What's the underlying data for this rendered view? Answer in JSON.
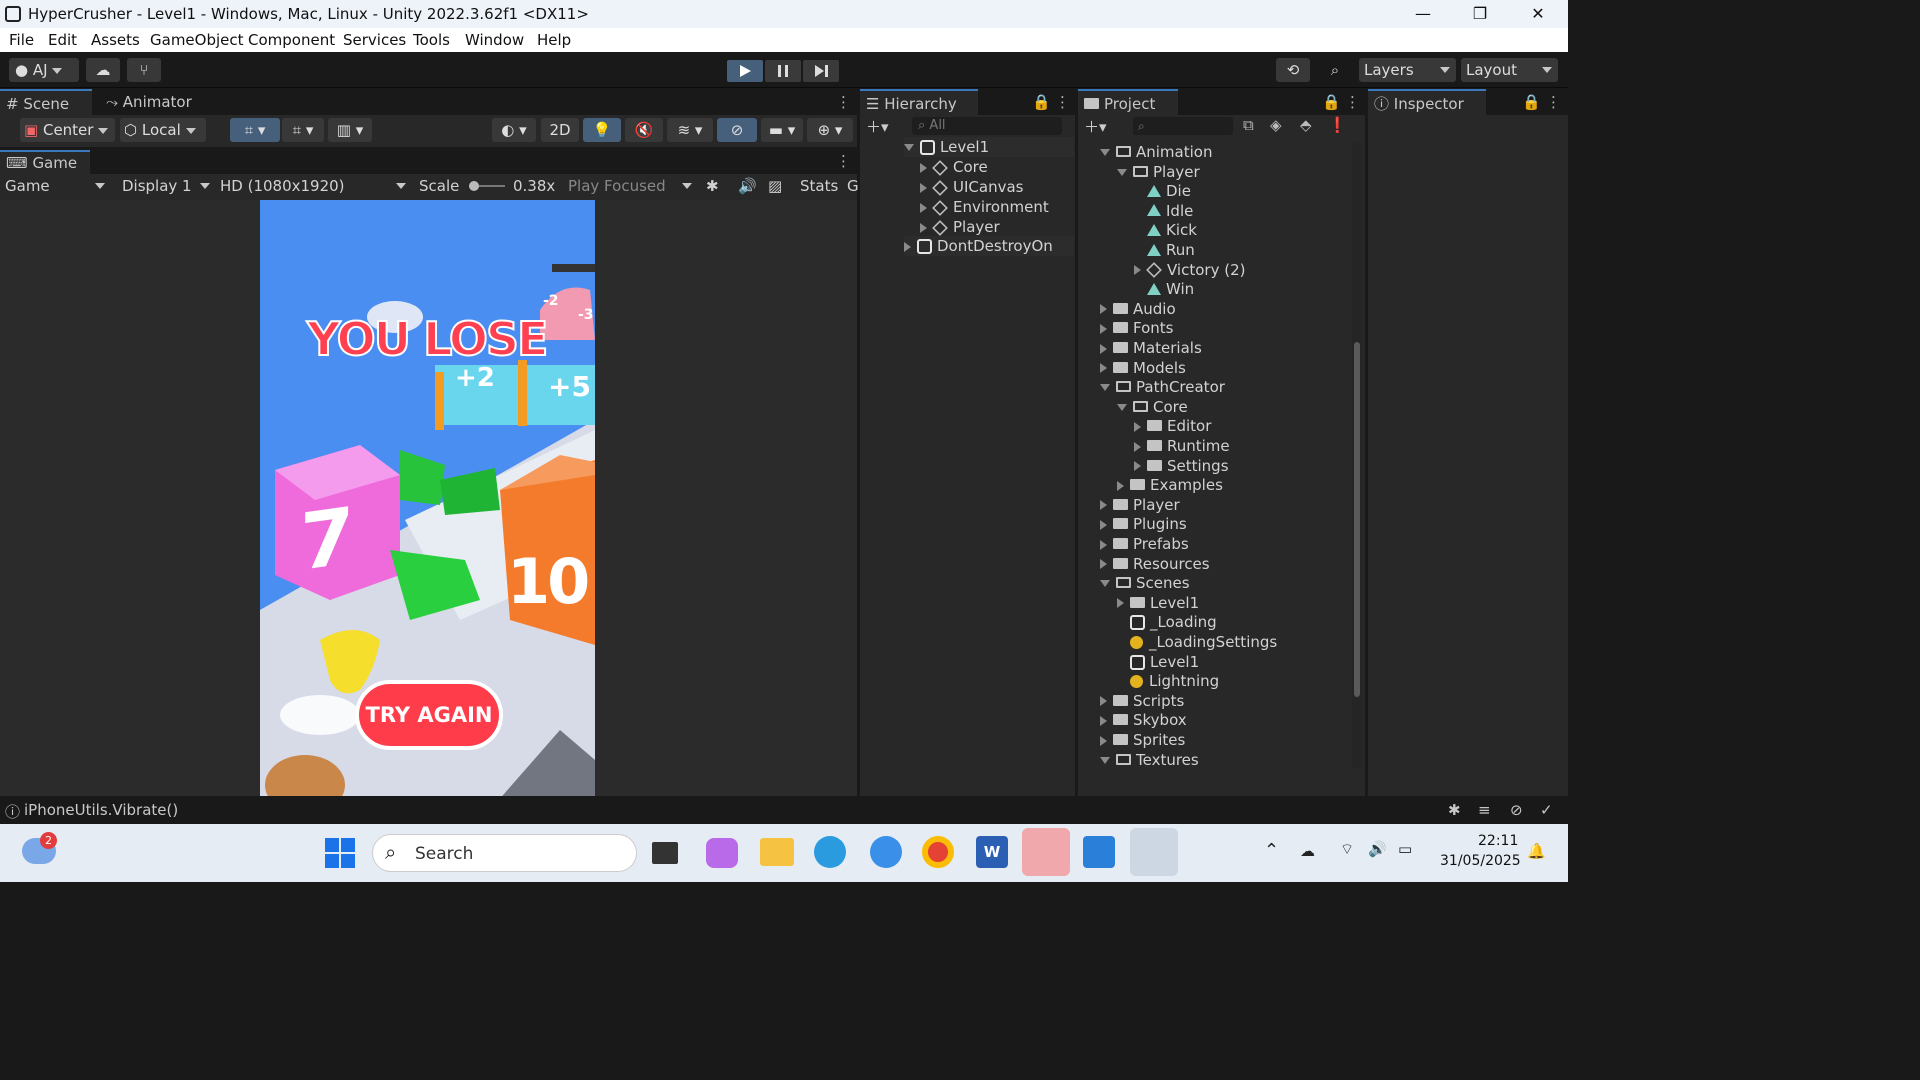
{
  "window": {
    "title": "HyperCrusher - Level1 - Windows, Mac, Linux - Unity 2022.3.62f1 <DX11>",
    "minimize": "—",
    "maximize": "❐",
    "close": "✕"
  },
  "menu": [
    "File",
    "Edit",
    "Assets",
    "GameObject",
    "Component",
    "Services",
    "Tools",
    "Window",
    "Help"
  ],
  "toolbar": {
    "account": "AJ",
    "layers": "Layers",
    "layout": "Layout"
  },
  "scene_tabs": {
    "scene": "Scene",
    "animator": "Animator",
    "game": "Game"
  },
  "scene_tools": {
    "pivot": "Center",
    "space": "Local",
    "mode2d": "2D"
  },
  "game_bar": {
    "view": "Game",
    "display": "Display 1",
    "resolution": "HD (1080x1920)",
    "scale_label": "Scale",
    "scale_value": "0.38x",
    "play_mode": "Play Focused",
    "stats": "Stats",
    "gizmos": "G"
  },
  "game_view": {
    "lose_text": "YOU LOSE",
    "try_again": "TRY AGAIN",
    "block1": "7",
    "block2": "10",
    "gate1": "+2",
    "gate2": "+5",
    "gate3": "-2",
    "gate4": "-3"
  },
  "hierarchy": {
    "title": "Hierarchy",
    "search": "All",
    "scene": "Level1",
    "children": [
      "Core",
      "UICanvas",
      "Environment",
      "Player"
    ],
    "dontdestroy": "DontDestroyOn"
  },
  "project": {
    "title": "Project",
    "items": [
      {
        "label": "Animation",
        "depth": 0,
        "kind": "folder-open",
        "arrow": "down"
      },
      {
        "label": "Player",
        "depth": 1,
        "kind": "folder-open",
        "arrow": "down"
      },
      {
        "label": "Die",
        "depth": 2,
        "kind": "anim",
        "arrow": "none"
      },
      {
        "label": "Idle",
        "depth": 2,
        "kind": "anim",
        "arrow": "none"
      },
      {
        "label": "Kick",
        "depth": 2,
        "kind": "anim",
        "arrow": "none"
      },
      {
        "label": "Run",
        "depth": 2,
        "kind": "anim",
        "arrow": "none"
      },
      {
        "label": "Victory (2)",
        "depth": 2,
        "kind": "cube",
        "arrow": "right"
      },
      {
        "label": "Win",
        "depth": 2,
        "kind": "anim",
        "arrow": "none"
      },
      {
        "label": "Audio",
        "depth": 0,
        "kind": "folder",
        "arrow": "right"
      },
      {
        "label": "Fonts",
        "depth": 0,
        "kind": "folder",
        "arrow": "right"
      },
      {
        "label": "Materials",
        "depth": 0,
        "kind": "folder",
        "arrow": "right"
      },
      {
        "label": "Models",
        "depth": 0,
        "kind": "folder",
        "arrow": "right"
      },
      {
        "label": "PathCreator",
        "depth": 0,
        "kind": "folder-open",
        "arrow": "down"
      },
      {
        "label": "Core",
        "depth": 1,
        "kind": "folder-open",
        "arrow": "down"
      },
      {
        "label": "Editor",
        "depth": 2,
        "kind": "folder",
        "arrow": "right"
      },
      {
        "label": "Runtime",
        "depth": 2,
        "kind": "folder",
        "arrow": "right"
      },
      {
        "label": "Settings",
        "depth": 2,
        "kind": "folder",
        "arrow": "right"
      },
      {
        "label": "Examples",
        "depth": 1,
        "kind": "folder",
        "arrow": "right"
      },
      {
        "label": "Player",
        "depth": 0,
        "kind": "folder",
        "arrow": "right"
      },
      {
        "label": "Plugins",
        "depth": 0,
        "kind": "folder",
        "arrow": "right"
      },
      {
        "label": "Prefabs",
        "depth": 0,
        "kind": "folder",
        "arrow": "right"
      },
      {
        "label": "Resources",
        "depth": 0,
        "kind": "folder",
        "arrow": "right"
      },
      {
        "label": "Scenes",
        "depth": 0,
        "kind": "folder-open",
        "arrow": "down"
      },
      {
        "label": "Level1",
        "depth": 1,
        "kind": "folder",
        "arrow": "right"
      },
      {
        "label": "_Loading",
        "depth": 1,
        "kind": "unity",
        "arrow": "none"
      },
      {
        "label": "_LoadingSettings",
        "depth": 1,
        "kind": "bulb",
        "arrow": "none"
      },
      {
        "label": "Level1",
        "depth": 1,
        "kind": "unity",
        "arrow": "none"
      },
      {
        "label": "Lightning",
        "depth": 1,
        "kind": "bulb",
        "arrow": "none"
      },
      {
        "label": "Scripts",
        "depth": 0,
        "kind": "folder",
        "arrow": "right"
      },
      {
        "label": "Skybox",
        "depth": 0,
        "kind": "folder",
        "arrow": "right"
      },
      {
        "label": "Sprites",
        "depth": 0,
        "kind": "folder",
        "arrow": "right"
      },
      {
        "label": "Textures",
        "depth": 0,
        "kind": "folder-open",
        "arrow": "down"
      }
    ]
  },
  "inspector": {
    "title": "Inspector"
  },
  "status": {
    "message": "iPhoneUtils.Vibrate()"
  },
  "taskbar": {
    "search": "Search",
    "time": "22:11",
    "date": "31/05/2025",
    "weather_badge": "2"
  }
}
